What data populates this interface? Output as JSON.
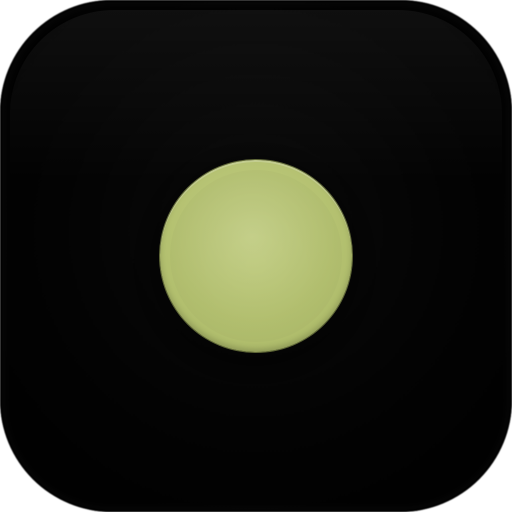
{
  "icon": {
    "name": "app-icon",
    "background_color": "#000000",
    "center_dot_color": "#b4c170",
    "shape": "rounded-square"
  }
}
